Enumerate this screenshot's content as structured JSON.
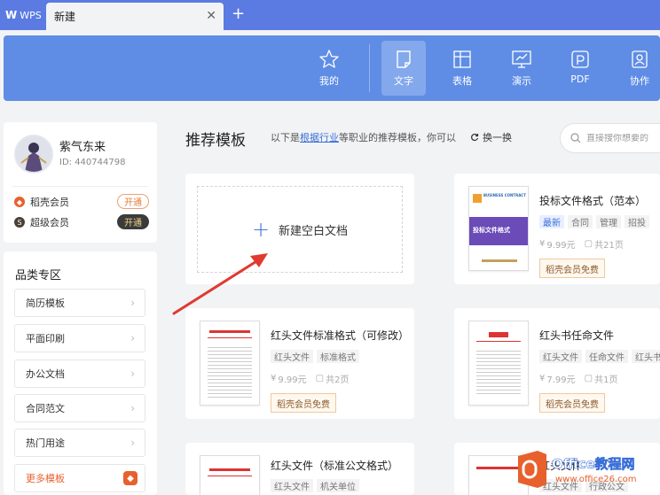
{
  "titlebar": {
    "app_tab": "WPS",
    "doc_tab": "新建"
  },
  "nav": [
    {
      "label": "我的",
      "icon": "star-icon"
    },
    {
      "label": "文字",
      "icon": "document-icon"
    },
    {
      "label": "表格",
      "icon": "table-icon"
    },
    {
      "label": "演示",
      "icon": "presentation-icon"
    },
    {
      "label": "PDF",
      "icon": "pdf-icon"
    },
    {
      "label": "协作",
      "icon": "collab-icon"
    }
  ],
  "user": {
    "name": "紫气东来",
    "id": "ID: 440744798",
    "members": [
      {
        "label": "稻壳会员",
        "button": "开通",
        "color": "#e8602c"
      },
      {
        "label": "超级会员",
        "button": "开通",
        "color": "#9c6a2f"
      }
    ]
  },
  "categories": {
    "title": "品类专区",
    "items": [
      "简历模板",
      "平面印刷",
      "办公文档",
      "合同范文",
      "热门用途",
      "更多模板"
    ]
  },
  "main": {
    "title": "推荐模板",
    "desc_prefix": "以下是",
    "desc_link": "根据行业",
    "desc_suffix": "等职业的推荐模板，你可以",
    "refresh": "换一换",
    "search_placeholder": "直接搜你想要的",
    "new_blank": "新建空白文档"
  },
  "templates": [
    {
      "name": "投标文件格式（范本）",
      "tags": [
        "最新",
        "合同",
        "管理",
        "招投"
      ],
      "price": "9.99元",
      "pages": "共21页",
      "free": "稻壳会员免费",
      "cover_title": "投标文件格式",
      "cover_sub": "BUSINESS CONTRACT"
    },
    {
      "name": "红头文件标准格式（可修改）",
      "tags": [
        "红头文件",
        "标准格式"
      ],
      "price": "9.99元",
      "pages": "共2页",
      "free": "稻壳会员免费"
    },
    {
      "name": "红头书任命文件",
      "tags": [
        "红头文件",
        "任命文件",
        "红头书"
      ],
      "price": "7.99元",
      "pages": "共1页",
      "free": "稻壳会员免费"
    },
    {
      "name": "红头文件（标准公文格式）",
      "tags": [
        "红头文件",
        "机关单位"
      ]
    },
    {
      "name": "红头文件",
      "tags": [
        "红头文件",
        "行政公文"
      ]
    }
  ],
  "watermark": {
    "brand": "Office教程网",
    "url": "www.office26.com"
  }
}
